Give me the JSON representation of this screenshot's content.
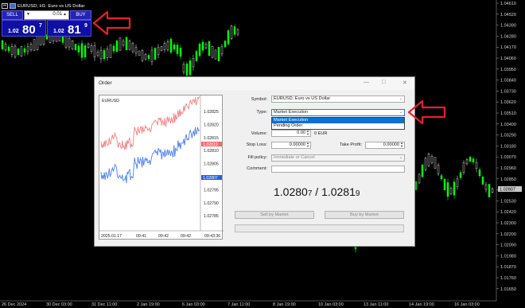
{
  "chart": {
    "symbol_title": "EURUSD, H1:  Euro vs US Dollar",
    "price_axis": [
      "1.04610",
      "1.04520",
      "1.04390",
      "1.04280",
      "1.04170",
      "1.04060",
      "1.03950",
      "1.03840",
      "1.03730",
      "1.03620",
      "1.03510",
      "1.03400",
      "1.03290",
      "1.03180",
      "1.03070",
      "1.02960",
      "1.02850",
      "1.02740",
      "1.02530",
      "1.02420",
      "1.02300",
      "1.02200",
      "1.02090",
      "1.01980",
      "1.01870",
      "1.01760",
      "1.01650"
    ],
    "current_price_label": "1.02807",
    "time_axis": [
      "26 Dec 2024",
      "30 Dec 03:00",
      "31 Dec 11:00",
      "2 Jan 19:00",
      "6 Jan 03:00",
      "7 Jan 11:00",
      "8 Jan 19:00",
      "10 Jan 03:00",
      "13 Jan 11:00",
      "14 Jan 19:00",
      "16 Jan 03:00"
    ],
    "colors": {
      "bull": "#00ff00",
      "bear": "#ffffff",
      "background": "#000000"
    }
  },
  "one_click": {
    "sell_label": "SELL",
    "buy_label": "BUY",
    "lot": "0.01",
    "sell_small": "1.02",
    "sell_big": "80",
    "sell_sup": "7",
    "buy_small": "1.02",
    "buy_big": "81",
    "buy_sup": "9"
  },
  "dialog": {
    "title": "Order",
    "minimize": "—",
    "maximize": "□",
    "close": "✕",
    "mini_chart": {
      "symbol": "EURUSD",
      "price_ticks": [
        "1.02825",
        "1.02820",
        "1.02815",
        "1.02810",
        "1.02805",
        "1.02800",
        "1.02795",
        "1.02790",
        "1.02785"
      ],
      "ask_label": "1.02819",
      "bid_label": "1.02807",
      "time_ticks": [
        "2025.01.17",
        "09:41",
        "09:42",
        "09:42",
        "09:43:36"
      ],
      "ask_color": "#f08080",
      "bid_color": "#4a7fe8"
    },
    "symbol_label": "Symbol:",
    "symbol_value": "EURUSD, Euro vs US Dollar",
    "type_label": "Type:",
    "type_value": "Market Execution",
    "type_options": [
      "Market Execution",
      "Pending Order"
    ],
    "volume_label": "Volume:",
    "volume_value": "0.00",
    "volume_unit": "0 EUR",
    "stoploss_label": "Stop Loss:",
    "stoploss_value": "0.00000",
    "takeprofit_label": "Take Profit:",
    "takeprofit_value": "0.00000",
    "fill_label": "Fill policy:",
    "fill_value": "Immediate or Cancel",
    "comment_label": "Comment:",
    "comment_value": "",
    "bid_main": "1.0280",
    "bid_last": "7",
    "separator": " / ",
    "ask_main": "1.0281",
    "ask_last": "9",
    "sell_button": "Sell by Market",
    "buy_button": "Buy by Market"
  },
  "annotation_color": "#e8202a"
}
